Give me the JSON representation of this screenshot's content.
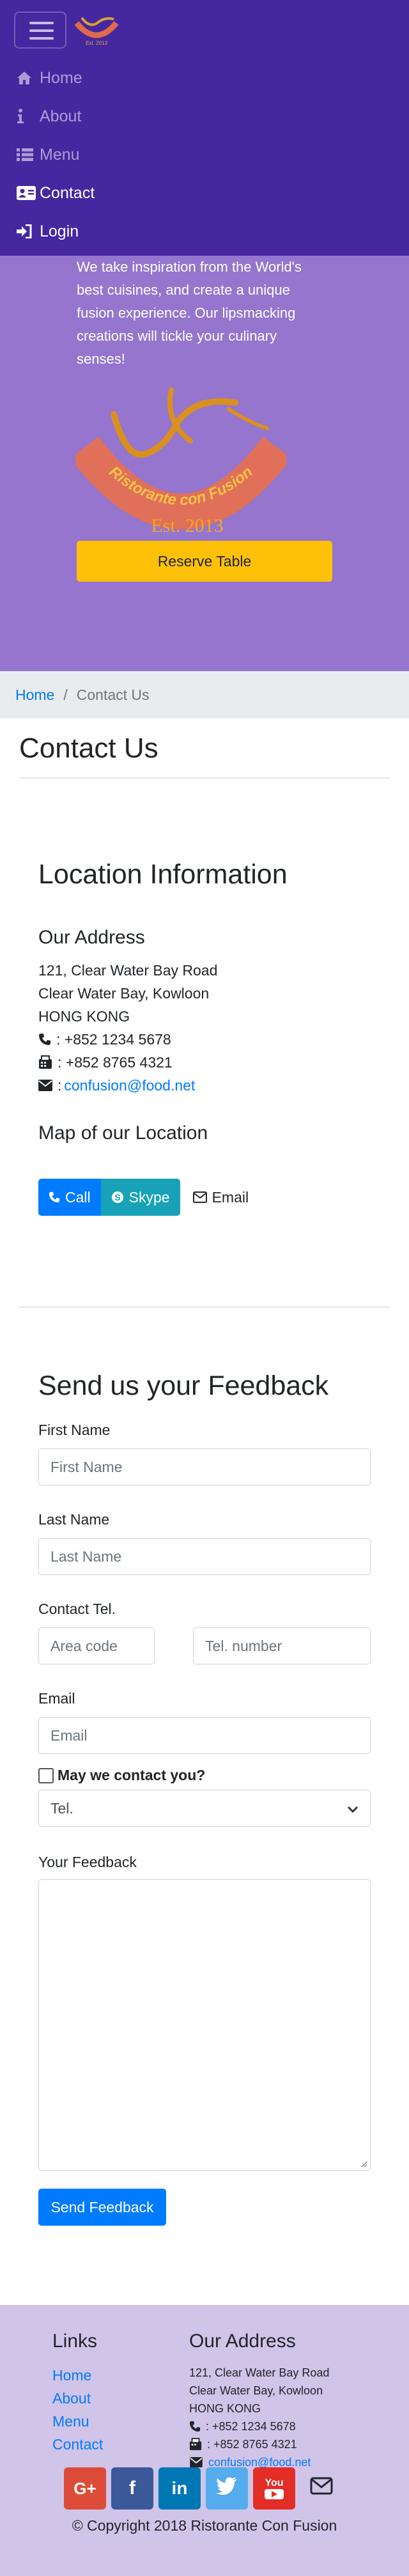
{
  "nav": {
    "items": [
      {
        "label": "Home",
        "icon": "home-icon"
      },
      {
        "label": "About",
        "icon": "info-icon"
      },
      {
        "label": "Menu",
        "icon": "list-icon"
      },
      {
        "label": "Contact",
        "icon": "address-card-icon",
        "active": true
      },
      {
        "label": "Login",
        "icon": "sign-in-icon"
      }
    ]
  },
  "jumbotron": {
    "lines": [
      "We take inspiration from the World's",
      "best cuisines, and create a unique",
      "fusion experience. Our lipsmacking",
      "creations will tickle your culinary",
      "senses!"
    ],
    "logo_text": "Ristorante con Fusion",
    "logo_year": "Est. 2013",
    "reserve_label": "Reserve Table"
  },
  "breadcrumb": {
    "home": "Home",
    "separator": "/",
    "current": "Contact Us"
  },
  "page_title": "Contact Us",
  "location": {
    "title": "Location Information",
    "address_title": "Our Address",
    "address_lines": [
      "121, Clear Water Bay Road",
      "Clear Water Bay, Kowloon",
      "HONG KONG"
    ],
    "phone": ": +852 1234 5678",
    "fax": ": +852 8765 4321",
    "email_prefix": ":",
    "email": "confusion@food.net",
    "map_title": "Map of our Location",
    "buttons": {
      "call": "Call",
      "skype": "Skype",
      "email": "Email"
    }
  },
  "feedback": {
    "title": "Send us your Feedback",
    "first_name": {
      "label": "First Name",
      "placeholder": "First Name"
    },
    "last_name": {
      "label": "Last Name",
      "placeholder": "Last Name"
    },
    "contact_tel": {
      "label": "Contact Tel.",
      "area_placeholder": "Area code",
      "number_placeholder": "Tel. number"
    },
    "email": {
      "label": "Email",
      "placeholder": "Email"
    },
    "may_contact": "May we contact you?",
    "contact_method": "Tel.",
    "feedback_label": "Your Feedback",
    "send_label": "Send Feedback"
  },
  "footer": {
    "links_title": "Links",
    "links": [
      "Home",
      "About",
      "Menu",
      "Contact"
    ],
    "address_title": "Our Address",
    "address_lines": [
      "121, Clear Water Bay Road",
      "Clear Water Bay, Kowloon",
      "HONG KONG"
    ],
    "phone": ": +852 1234 5678",
    "fax": ": +852 8765 4321",
    "email": "confusion@food.net",
    "socials": {
      "gplus": "G+",
      "facebook": "f",
      "linkedin": "in",
      "youtube": "You"
    },
    "copyright": "© Copyright 2018 Ristorante Con Fusion"
  },
  "colors": {
    "navbar": "#4527a0",
    "jumbotron": "#9575cd",
    "footer": "#d1c4e9",
    "primary": "#007bff",
    "warning": "#ffc107",
    "info": "#17a2b8"
  }
}
